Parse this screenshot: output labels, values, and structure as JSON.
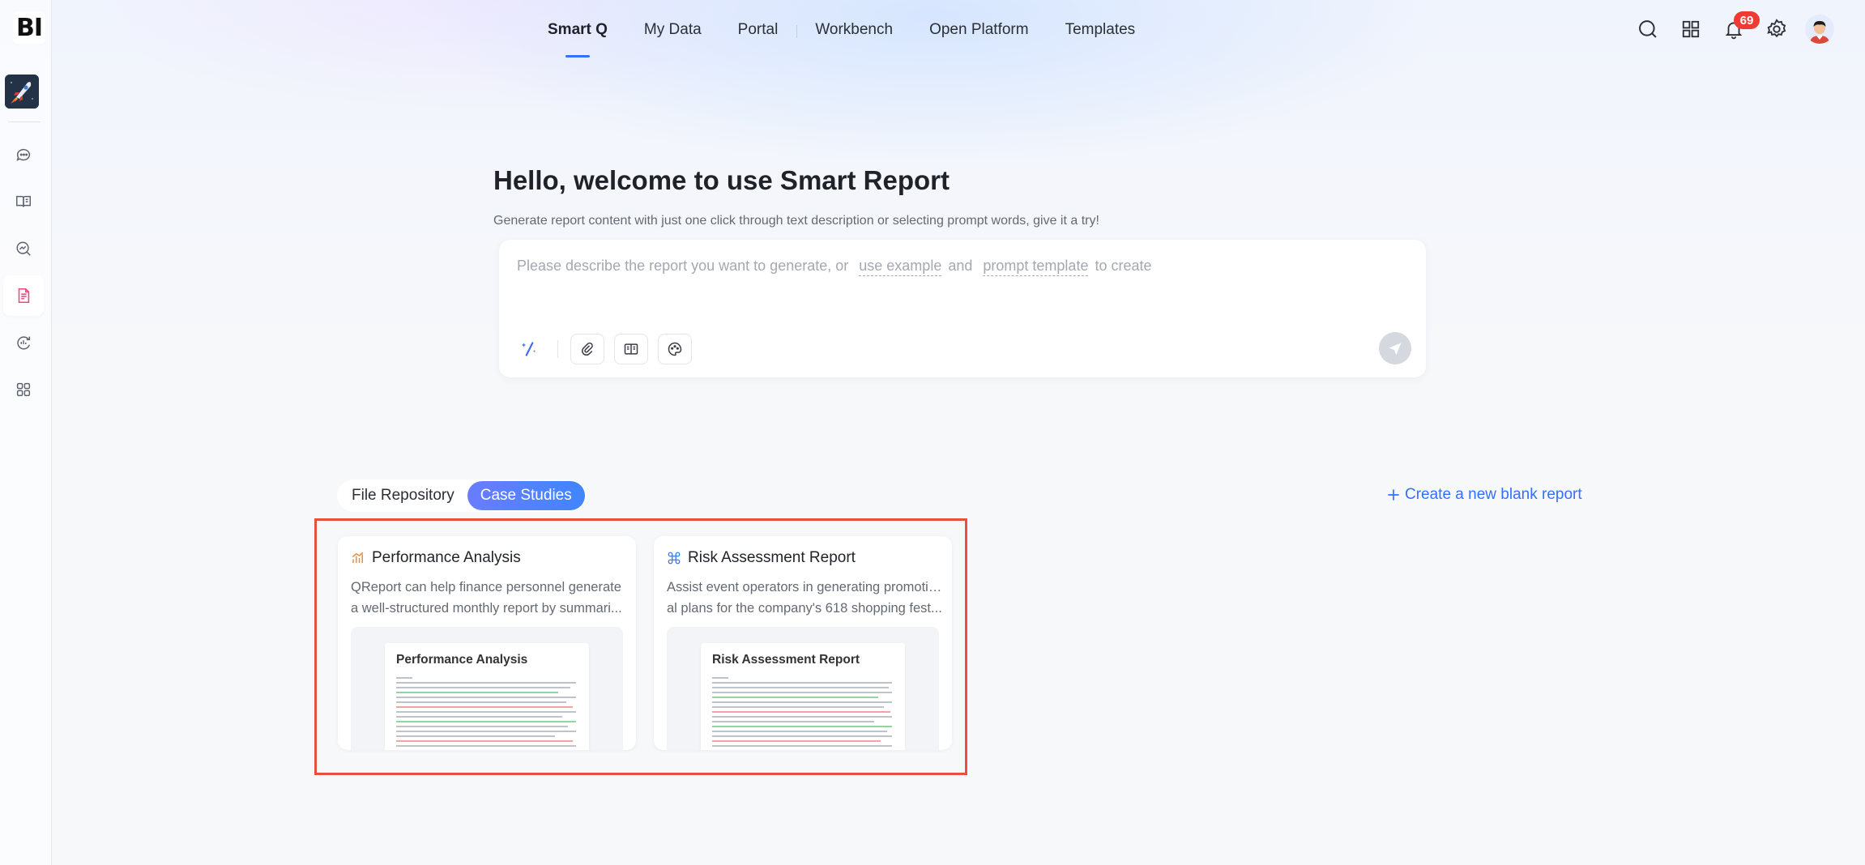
{
  "sidebar": {
    "logo": "BI",
    "items": [
      {
        "icon": "chat-bubble-icon",
        "active": false
      },
      {
        "icon": "book-open-icon",
        "active": false
      },
      {
        "icon": "search-chart-icon",
        "active": false
      },
      {
        "icon": "report-document-icon",
        "active": true
      },
      {
        "icon": "analytics-cycle-icon",
        "active": false
      },
      {
        "icon": "apps-grid-icon",
        "active": false
      }
    ]
  },
  "nav": {
    "tabs": [
      "Smart Q",
      "My Data",
      "Portal",
      "Workbench",
      "Open Platform",
      "Templates"
    ],
    "active": "Smart Q"
  },
  "header": {
    "notification_count": "69",
    "icons": [
      "search-icon",
      "apps-icon",
      "bell-icon",
      "gear-icon",
      "user-avatar"
    ]
  },
  "hero": {
    "title": "Hello, welcome to use Smart Report",
    "subtitle": "Generate report content with just one click through text description or selecting prompt words, give it a try!"
  },
  "prompt": {
    "text_start": "Please describe the report you want to generate, or",
    "link_example": "use example",
    "text_and": "and",
    "link_template": "prompt template",
    "text_end": "to create"
  },
  "segment": {
    "options": [
      "File Repository",
      "Case Studies"
    ],
    "active": "Case Studies"
  },
  "create_link": "Create a new blank report",
  "cards": [
    {
      "title": "Performance Analysis",
      "desc_line1": "QReport can help finance personnel generate",
      "desc_line2": "a well-structured monthly report by summari...",
      "preview_title": "Performance Analysis",
      "icon": "bar-chart-icon"
    },
    {
      "title": "Risk Assessment Report",
      "desc_line1": "Assist event operators in generating promotion",
      "desc_line2": "al plans for the company's 618 shopping fest...",
      "preview_title": "Risk Assessment Report",
      "icon": "command-icon"
    }
  ],
  "colors": {
    "accent": "#3370ff",
    "badge": "#f03a33",
    "highlight": "#e6503c"
  }
}
